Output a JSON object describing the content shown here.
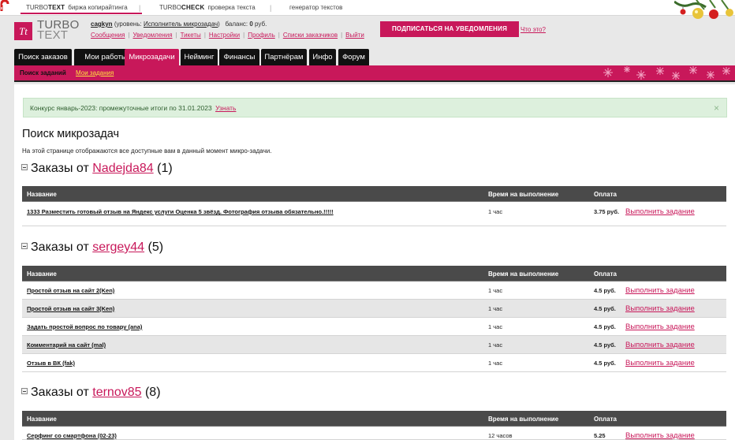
{
  "topbar": {
    "products": [
      {
        "brand": "TURBO",
        "brand_bold": "TEXT",
        "desc": "биржа копирайтинга"
      },
      {
        "brand": "TURBO",
        "brand_bold": "CHECK",
        "desc": "проверка текста"
      },
      {
        "brand": "",
        "brand_bold": "",
        "desc": "генератор текстов"
      }
    ]
  },
  "logo": {
    "mark": "Tt",
    "line1": "TURBO",
    "line2": "TEXT"
  },
  "user": {
    "name": "cagkyn",
    "level_prefix": "(уровень:",
    "level": "Исполнитель микрозадач",
    "level_suffix": ")",
    "balance_label": "баланс:",
    "balance_value": "0",
    "balance_unit": "руб.",
    "links": [
      "Сообщения",
      "Уведомления",
      "Тикеты",
      "Настройки",
      "Профиль",
      "Списки заказчиков",
      "Выйти"
    ]
  },
  "subscribe": {
    "label": "ПОДПИСАТЬСЯ НА УВЕДОМЛЕНИЯ",
    "whatis": "Что это?"
  },
  "nav": {
    "tabs": [
      "Поиск заказов",
      "Мои работы",
      "Микрозадачи",
      "Нейминг",
      "Финансы",
      "Партнёрам",
      "Инфо",
      "Форум"
    ],
    "active": "Микрозадачи"
  },
  "subnav": {
    "active": "Поиск заданий",
    "other": "Мои задания"
  },
  "notice": {
    "text": "Конкурс январь-2023: промежуточные итоги по 31.01.2023",
    "link": "Узнать",
    "close": "×"
  },
  "page": {
    "title": "Поиск микрозадач",
    "description": "На этой странице отображаются все доступные вам в данный момент микро-задачи."
  },
  "table_headers": {
    "name": "Название",
    "time": "Время на выполнение",
    "pay": "Оплата"
  },
  "action_label": "Выполнить задание",
  "groups": [
    {
      "prefix": "Заказы от",
      "user": "Nadejda84",
      "count": "(1)",
      "rows": [
        {
          "name": "1333 Разместить готовый отзыв на Яндекс услуги Оценка 5 звёзд. Фотография отзыва обязательно.!!!!!",
          "time": "1 час",
          "pay": "3.75 руб."
        }
      ]
    },
    {
      "prefix": "Заказы от",
      "user": "sergey44",
      "count": "(5)",
      "rows": [
        {
          "name": "Простой отзыв на сайт 2(Ken)",
          "time": "1 час",
          "pay": "4.5 руб."
        },
        {
          "name": "Простой отзыв на сайт 3(Ken)",
          "time": "1 час",
          "pay": "4.5 руб."
        },
        {
          "name": "Задать простой вопрос по товару (ana)",
          "time": "1 час",
          "pay": "4.5 руб."
        },
        {
          "name": "Комментарий на сайт (mal)",
          "time": "1 час",
          "pay": "4.5 руб."
        },
        {
          "name": "Отзыв в ВК (fak)",
          "time": "1 час",
          "pay": "4.5 руб."
        }
      ]
    },
    {
      "prefix": "Заказы от",
      "user": "ternov85",
      "count": "(8)",
      "rows": [
        {
          "name": "Серфинг со смартфона (02-23)",
          "time": "12 часов",
          "pay": "5.25"
        }
      ]
    }
  ],
  "colors": {
    "accent": "#c8185a",
    "nav": "#111111",
    "header_row": "#4a4a4a",
    "notice_bg": "#ddf0dd"
  }
}
